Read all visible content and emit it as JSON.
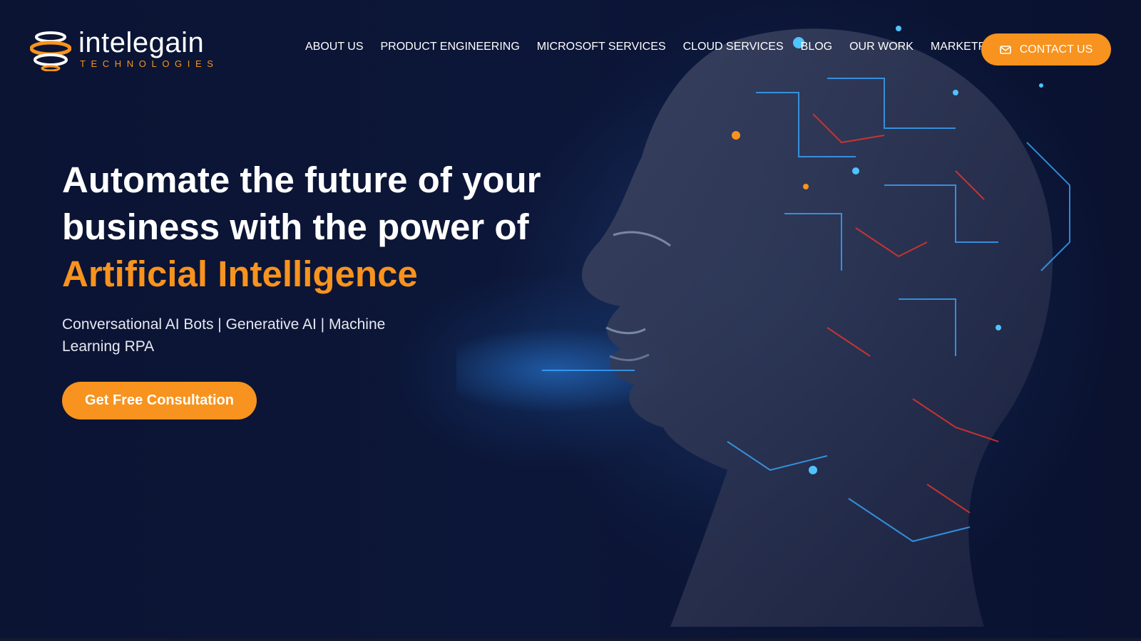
{
  "brand": {
    "name": "intelegain",
    "tagline": "TECHNOLOGIES",
    "accent_color": "#f7931e",
    "background_color": "#0b1433"
  },
  "nav": {
    "items": [
      {
        "label": "ABOUT US"
      },
      {
        "label": "PRODUCT ENGINEERING"
      },
      {
        "label": "MICROSOFT SERVICES"
      },
      {
        "label": "CLOUD SERVICES"
      },
      {
        "label": "BLOG"
      },
      {
        "label": "OUR WORK"
      },
      {
        "label": "MARKETPLACE"
      }
    ],
    "contact": {
      "label": "CONTACT US",
      "icon": "mail-icon"
    }
  },
  "hero": {
    "headline_line1": "Automate the future of your",
    "headline_line2": "business with the power of",
    "headline_accent": "Artificial Intelligence",
    "subtext": "Conversational AI Bots | Generative AI | Machine Learning RPA",
    "cta_label": "Get Free Consultation",
    "image": "ai-robot-head-illustration"
  }
}
